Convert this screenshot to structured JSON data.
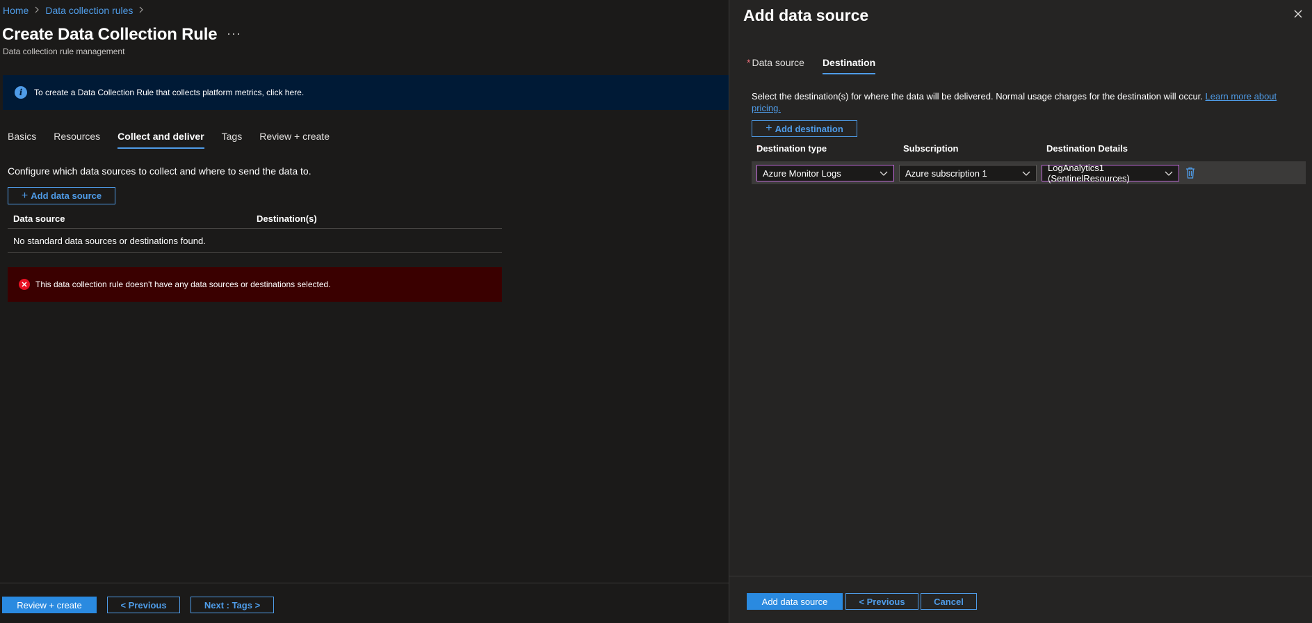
{
  "breadcrumb": {
    "home": "Home",
    "rules": "Data collection rules",
    "sep": ">"
  },
  "page": {
    "title": "Create Data Collection Rule",
    "more": "···",
    "subtitle": "Data collection rule management"
  },
  "info_banner": {
    "icon": "i",
    "text": "To create a Data Collection Rule that collects platform metrics, click here."
  },
  "tabs": [
    "Basics",
    "Resources",
    "Collect and deliver",
    "Tags",
    "Review + create"
  ],
  "collect": {
    "instructions": "Configure which data sources to collect and where to send the data to.",
    "add_button": "Add data source",
    "table": {
      "headers": [
        "Data source",
        "Destination(s)"
      ],
      "empty_message": "No standard data sources or destinations found."
    },
    "error_text": "This data collection rule doesn't have any data sources or destinations selected.",
    "error_icon": "✕"
  },
  "footer": {
    "review": "Review + create",
    "previous": "< Previous",
    "next": "Next : Tags >"
  },
  "panel": {
    "title": "Add data source",
    "tabs": {
      "data_source": "Data source",
      "destination": "Destination",
      "required_marker": "*"
    },
    "description": "Select the destination(s) for where the data will be delivered. Normal usage charges for the destination will occur.",
    "learn_more": "Learn more about pricing.",
    "add_destination": "Add destination",
    "columns": {
      "type": "Destination type",
      "subscription": "Subscription",
      "details": "Destination Details"
    },
    "row": {
      "type": "Azure Monitor Logs",
      "subscription": "Azure subscription 1",
      "details": "LogAnalytics1 (SentinelResources)"
    },
    "buttons": {
      "add": "Add data source",
      "previous": "< Previous",
      "cancel": "Cancel"
    }
  },
  "colors": {
    "accent": "#4f9ce8",
    "primary_button": "#2a8ae0",
    "error_bg": "#3a0000",
    "info_bg": "#001a36",
    "focus_border": "#c06ad8"
  },
  "icons": [
    "chevron-right-icon",
    "more-icon",
    "info-icon",
    "plus-icon",
    "error-icon",
    "close-icon",
    "chevron-down-icon",
    "trash-icon"
  ]
}
